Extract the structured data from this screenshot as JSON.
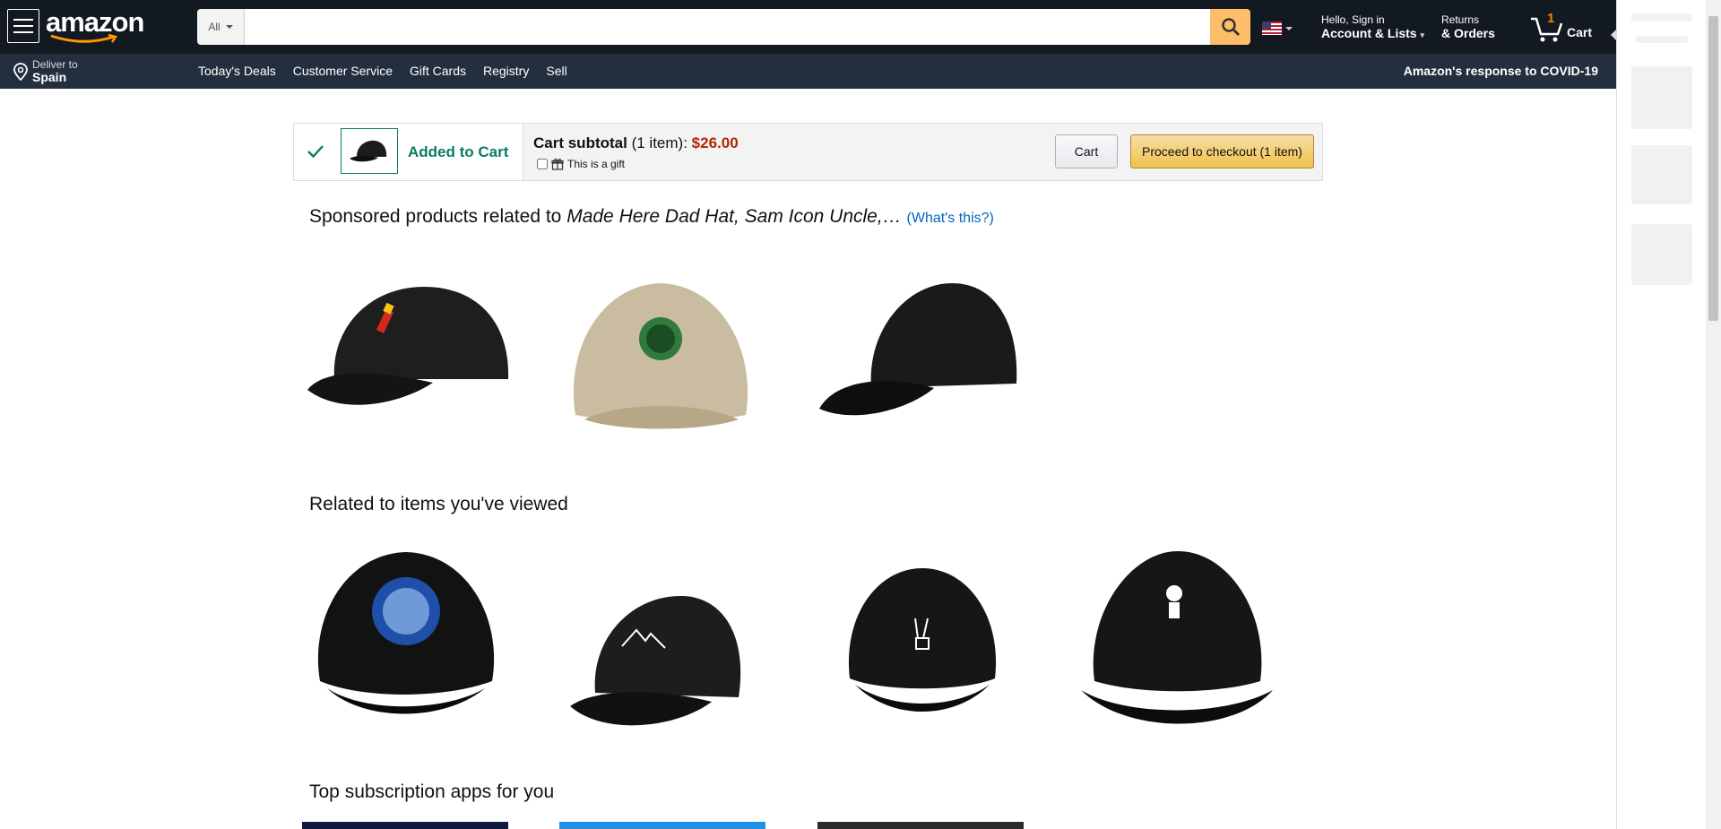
{
  "header": {
    "logo_text": "amazon",
    "search_category": "All",
    "search_placeholder": "",
    "account_line1": "Hello, Sign in",
    "account_line2": "Account & Lists",
    "returns_line1": "Returns",
    "returns_line2": "& Orders",
    "cart_count": "1",
    "cart_label": "Cart"
  },
  "subnav": {
    "deliver_line1": "Deliver to",
    "deliver_line2": "Spain",
    "links": [
      "Today's Deals",
      "Customer Service",
      "Gift Cards",
      "Registry",
      "Sell"
    ],
    "covid": "Amazon's response to COVID-19"
  },
  "cart_bar": {
    "added_text": "Added to Cart",
    "subtotal_label": "Cart subtotal",
    "subtotal_items": "(1 item):",
    "subtotal_price": "$26.00",
    "gift_label": "This is a gift",
    "cart_button": "Cart",
    "checkout_button": "Proceed to checkout (1 item)"
  },
  "sponsored": {
    "prefix": "Sponsored products related to",
    "query": "Made Here Dad Hat, Sam Icon Uncle,…",
    "whats_this": "(What's this?)"
  },
  "related": {
    "title": "Related to items you've viewed"
  },
  "apps": {
    "title": "Top subscription apps for you"
  },
  "colors": {
    "nav_dark": "#131921",
    "nav_secondary": "#232f3e",
    "search_button": "#febd69",
    "success_green": "#067d62",
    "price_red": "#b12704",
    "link_blue": "#0066c0"
  }
}
